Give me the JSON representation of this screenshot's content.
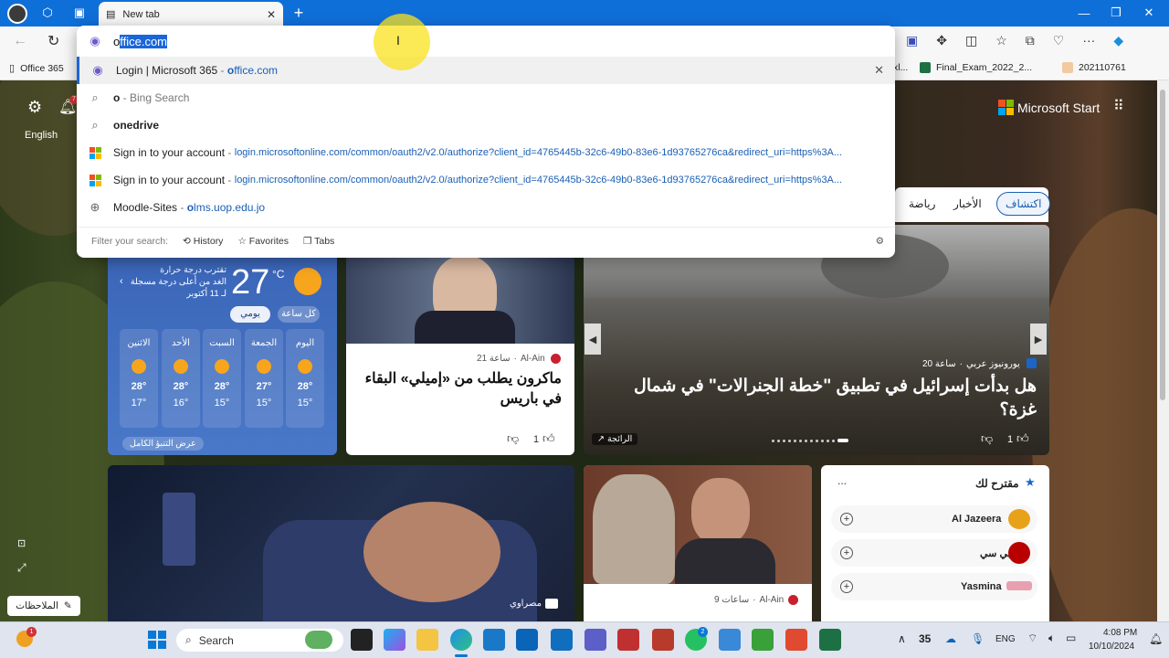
{
  "browser": {
    "tab_title": "New tab",
    "address_prefix": "o",
    "address_selected": "ffice.com",
    "favorites": [
      {
        "label": "Office 365"
      },
      {
        "label": "xl..."
      },
      {
        "label": "Final_Exam_2022_2..."
      },
      {
        "label": "202110761"
      }
    ]
  },
  "suggestions": {
    "rows": [
      {
        "title": "Login | Microsoft 365",
        "sep": " - ",
        "url_bold": "o",
        "url_rest": "ffice.com",
        "icon": "m365-icon"
      },
      {
        "title": "o",
        "sep": " - ",
        "url_bold": "",
        "url_rest": "Bing Search",
        "icon": "search-icon"
      },
      {
        "title_bold": "o",
        "title": "nedrive",
        "icon": "search-icon"
      },
      {
        "title": "Sign in to your account",
        "sep": " - ",
        "url_rest": "login.microsoftonline.com/common/oauth2/v2.0/authorize?client_id=4765445b-32c6-49b0-83e6-1d93765276ca&redirect_uri=https%3A...",
        "icon": "microsoft-icon"
      },
      {
        "title": "Sign in to your account",
        "sep": " - ",
        "url_rest": "login.microsoftonline.com/common/oauth2/v2.0/authorize?client_id=4765445b-32c6-49b0-83e6-1d93765276ca&redirect_uri=https%3A...",
        "icon": "microsoft-icon"
      },
      {
        "title": "Moodle-Sites",
        "sep": " - ",
        "url_bold": "o",
        "url_rest": "lms.uop.edu.jo",
        "icon": "globe-icon"
      }
    ],
    "filter_label": "Filter your search:",
    "filters": [
      "History",
      "Favorites",
      "Tabs"
    ]
  },
  "page": {
    "settings_label": "English",
    "notification_count": "7",
    "brand": "Microsoft Start",
    "nav_tabs": [
      "اكتشاف",
      "الأخبار",
      "رياضة"
    ],
    "notes_button": "الملاحظات",
    "weather": {
      "temp": "27",
      "unit": "°C",
      "line1": "تقترب درجة حرارة",
      "line2": "الغد من أعلى درجة مسجلة",
      "line3": "لـ 11 أكتوبر",
      "toggle_daily": "يومي",
      "toggle_hourly": "كل ساعة",
      "days": [
        {
          "name": "اليوم",
          "hi": "28°",
          "lo": "15°"
        },
        {
          "name": "الجمعة",
          "hi": "27°",
          "lo": "15°"
        },
        {
          "name": "السبت",
          "hi": "28°",
          "lo": "15°"
        },
        {
          "name": "الأحد",
          "hi": "28°",
          "lo": "16°"
        },
        {
          "name": "الاثنين",
          "hi": "28°",
          "lo": "17°"
        }
      ],
      "forecast_link": "عرض التنبؤ الكامل"
    },
    "story_main": {
      "source": "يورونيوز عربي",
      "age": "20 ساعة",
      "headline": "هل بدأت إسرائيل في تطبيق \"خطة الجنرالات\" في شمال غزة؟",
      "likes": "1",
      "badge": "الرائجة"
    },
    "story_macron": {
      "source": "Al-Ain",
      "age": "21 ساعة",
      "headline": "ماكرون يطلب من «إميلي» البقاء في باريس",
      "likes": "1"
    },
    "story_sleep": {
      "source": "مصراوي"
    },
    "story_tata": {
      "source": "Al-Ain",
      "age": "9 ساعات"
    },
    "suggested": {
      "title": "مقترح لك",
      "more": "...",
      "items": [
        "Al Jazeera",
        "بي بي سي",
        "Yasmina"
      ]
    }
  },
  "taskbar": {
    "search_label": "Search",
    "weather_temp": "35",
    "lang": "ENG",
    "time": "4:08 PM",
    "date": "10/10/2024",
    "whatsapp_badge": "2",
    "start_badge": "1"
  }
}
